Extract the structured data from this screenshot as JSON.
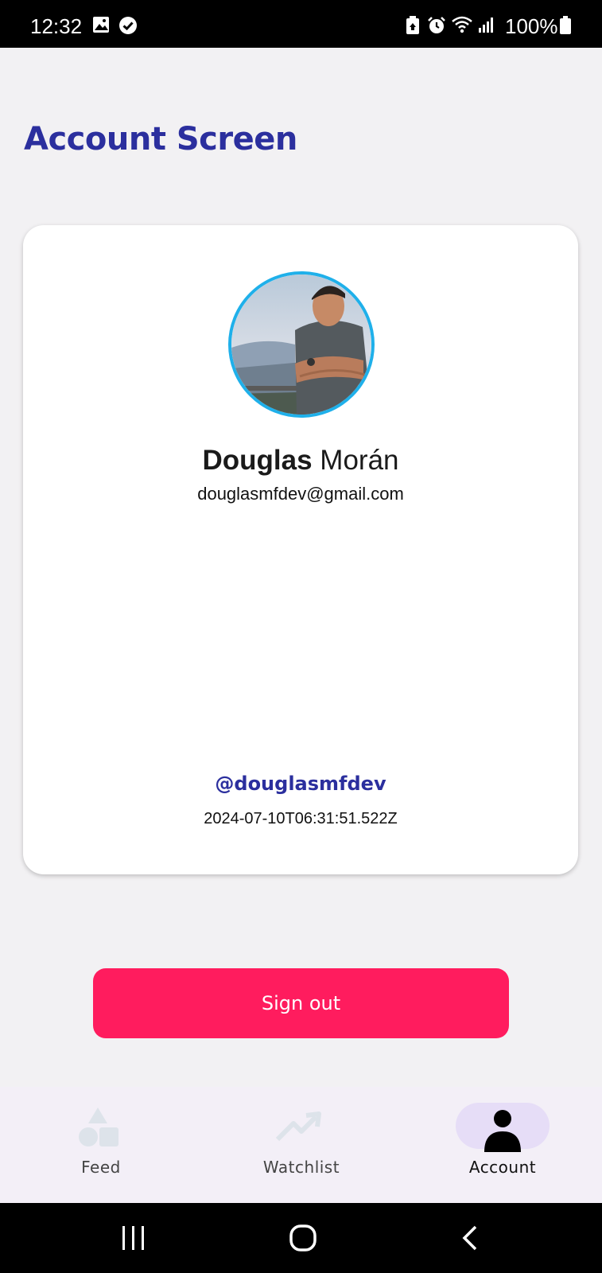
{
  "status_bar": {
    "time": "12:32",
    "battery": "100%",
    "icons": [
      "image-icon",
      "check-circle-icon",
      "battery-saver-icon",
      "alarm-icon",
      "wifi-icon",
      "signal-icon",
      "battery-icon"
    ]
  },
  "header": {
    "title": "Account Screen"
  },
  "profile": {
    "first_name": "Douglas",
    "last_name": "Morán",
    "email": "douglasmfdev@gmail.com",
    "handle": "@douglasmfdev",
    "timestamp": "2024-07-10T06:31:51.522Z"
  },
  "actions": {
    "signout_label": "Sign out"
  },
  "bottom_nav": {
    "items": [
      {
        "label": "Feed",
        "icon": "shapes-icon",
        "active": false
      },
      {
        "label": "Watchlist",
        "icon": "trending-up-icon",
        "active": false
      },
      {
        "label": "Account",
        "icon": "person-icon",
        "active": true
      }
    ]
  },
  "colors": {
    "accent": "#2b2f9e",
    "signout": "#ff1c5e",
    "avatar_ring": "#1fb0ea",
    "nav_active_pill": "#e6ddf7"
  }
}
